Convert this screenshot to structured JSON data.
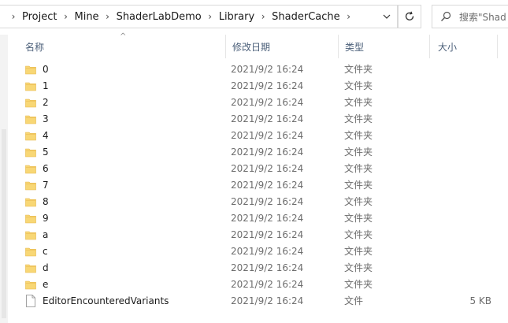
{
  "address": {
    "crumbs": [
      "Project",
      "Mine",
      "ShaderLabDemo",
      "Library",
      "ShaderCache"
    ]
  },
  "search": {
    "placeholder": "搜索\"Shad"
  },
  "columns": {
    "name": "名称",
    "date": "修改日期",
    "type": "类型",
    "size": "大小"
  },
  "files": [
    {
      "name": "0",
      "date": "2021/9/2 16:24",
      "type": "文件夹",
      "size": "",
      "icon": "folder-icon"
    },
    {
      "name": "1",
      "date": "2021/9/2 16:24",
      "type": "文件夹",
      "size": "",
      "icon": "folder-icon"
    },
    {
      "name": "2",
      "date": "2021/9/2 16:24",
      "type": "文件夹",
      "size": "",
      "icon": "folder-icon"
    },
    {
      "name": "3",
      "date": "2021/9/2 16:24",
      "type": "文件夹",
      "size": "",
      "icon": "folder-icon"
    },
    {
      "name": "4",
      "date": "2021/9/2 16:24",
      "type": "文件夹",
      "size": "",
      "icon": "folder-icon"
    },
    {
      "name": "5",
      "date": "2021/9/2 16:24",
      "type": "文件夹",
      "size": "",
      "icon": "folder-icon"
    },
    {
      "name": "6",
      "date": "2021/9/2 16:24",
      "type": "文件夹",
      "size": "",
      "icon": "folder-icon"
    },
    {
      "name": "7",
      "date": "2021/9/2 16:24",
      "type": "文件夹",
      "size": "",
      "icon": "folder-icon"
    },
    {
      "name": "8",
      "date": "2021/9/2 16:24",
      "type": "文件夹",
      "size": "",
      "icon": "folder-icon"
    },
    {
      "name": "9",
      "date": "2021/9/2 16:24",
      "type": "文件夹",
      "size": "",
      "icon": "folder-icon"
    },
    {
      "name": "a",
      "date": "2021/9/2 16:24",
      "type": "文件夹",
      "size": "",
      "icon": "folder-icon"
    },
    {
      "name": "c",
      "date": "2021/9/2 16:24",
      "type": "文件夹",
      "size": "",
      "icon": "folder-icon"
    },
    {
      "name": "d",
      "date": "2021/9/2 16:24",
      "type": "文件夹",
      "size": "",
      "icon": "folder-icon"
    },
    {
      "name": "e",
      "date": "2021/9/2 16:24",
      "type": "文件夹",
      "size": "",
      "icon": "folder-icon"
    },
    {
      "name": "EditorEncounteredVariants",
      "date": "2021/9/2 16:24",
      "type": "文件",
      "size": "5 KB",
      "icon": "file-icon"
    }
  ],
  "colors": {
    "folder": "#f8d775",
    "folder_dark": "#e7b84a",
    "header_text": "#4c607a",
    "meta_text": "#6d6d6d"
  }
}
